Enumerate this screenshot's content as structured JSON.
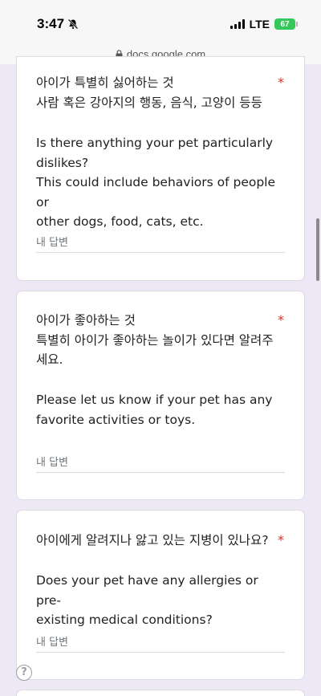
{
  "status_bar": {
    "time": "3:47",
    "network": "LTE",
    "battery": "67"
  },
  "browser": {
    "url": "docs.google.com"
  },
  "questions": [
    {
      "title_ko_line1": "아이가 특별히 싫어하는 것",
      "title_ko_line2": "사람 혹은 강아지의 행동, 음식, 고양이 등등",
      "desc_en_line1": "Is there anything your pet particularly",
      "desc_en_line2": "dislikes?",
      "desc_en_line3": "This could include behaviors of people or",
      "desc_en_line4": "other dogs, food, cats, etc.",
      "required": "*",
      "answer_placeholder": "내 답변"
    },
    {
      "title_ko_line1": "아이가 좋아하는 것",
      "title_ko_line2": "특별히 아이가 좋아하는 놀이가 있다면 알려주",
      "title_ko_line3": "세요.",
      "desc_en_line1": "Please let us know if your pet has any",
      "desc_en_line2": "favorite activities or toys.",
      "required": "*",
      "answer_placeholder": "내 답변"
    },
    {
      "title_ko_line1": "아이에게 알려지나 앓고 있는 지병이 있나요?",
      "desc_en_line1": "Does your pet have any allergies or pre-",
      "desc_en_line2": "existing medical conditions?",
      "required": "*",
      "answer_placeholder": "내 답변"
    }
  ],
  "help_label": "?"
}
